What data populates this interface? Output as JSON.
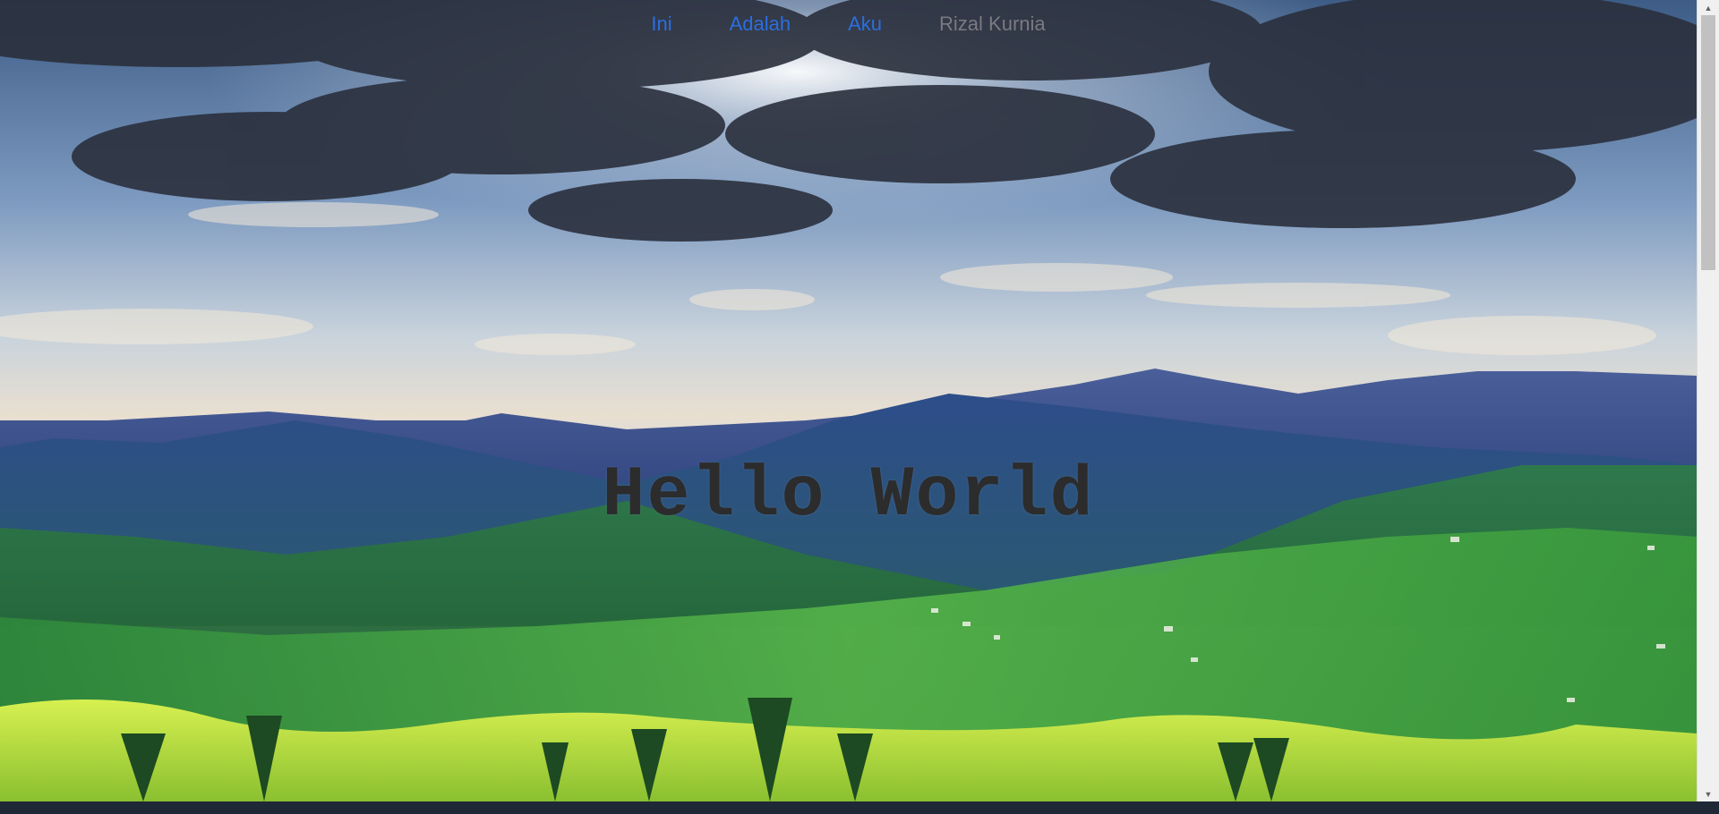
{
  "nav": {
    "items": [
      {
        "label": "Ini"
      },
      {
        "label": "Adalah"
      },
      {
        "label": "Aku"
      },
      {
        "label": "Rizal Kurnia"
      }
    ]
  },
  "hero": {
    "title": "Hello World"
  },
  "colors": {
    "link": "#2a6fe0",
    "link_faded": "#7a7a82",
    "heading": "#2c2c2c",
    "taskbar": "#1f2837"
  },
  "icons": {
    "scroll_up": "triangle-up",
    "scroll_down": "triangle-down"
  }
}
